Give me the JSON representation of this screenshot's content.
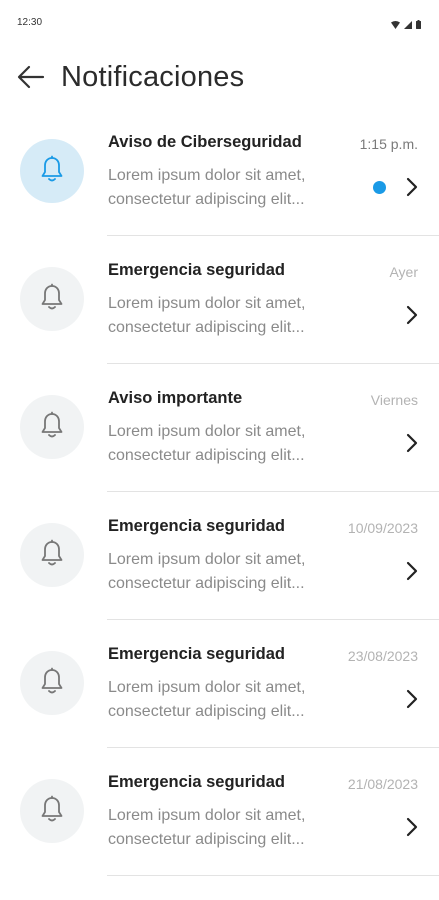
{
  "status_bar": {
    "time": "12:30"
  },
  "header": {
    "title": "Notificaciones",
    "back_icon": "arrow-left-icon"
  },
  "colors": {
    "accent": "#1a9ae6",
    "unread_avatar_bg": "#d6ebf7",
    "avatar_bg": "#f1f3f4"
  },
  "notifications": [
    {
      "title": "Aviso de Ciberseguridad",
      "time": "1:15 p.m.",
      "line1": "Lorem ipsum dolor sit amet,",
      "line2": "consectetur adipiscing elit...",
      "unread": true,
      "icon": "bell-icon"
    },
    {
      "title": "Emergencia seguridad",
      "time": "Ayer",
      "line1": "Lorem ipsum dolor sit amet,",
      "line2": "consectetur adipiscing elit...",
      "unread": false,
      "icon": "bell-icon"
    },
    {
      "title": "Aviso importante",
      "time": "Viernes",
      "line1": "Lorem ipsum dolor sit amet,",
      "line2": "consectetur adipiscing elit...",
      "unread": false,
      "icon": "bell-icon"
    },
    {
      "title": "Emergencia seguridad",
      "time": "10/09/2023",
      "line1": "Lorem ipsum dolor sit amet,",
      "line2": "consectetur adipiscing elit...",
      "unread": false,
      "icon": "bell-icon"
    },
    {
      "title": "Emergencia seguridad",
      "time": "23/08/2023",
      "line1": "Lorem ipsum dolor sit amet,",
      "line2": "consectetur adipiscing elit...",
      "unread": false,
      "icon": "bell-icon"
    },
    {
      "title": "Emergencia seguridad",
      "time": "21/08/2023",
      "line1": "Lorem ipsum dolor sit amet,",
      "line2": "consectetur adipiscing elit...",
      "unread": false,
      "icon": "bell-icon"
    }
  ]
}
